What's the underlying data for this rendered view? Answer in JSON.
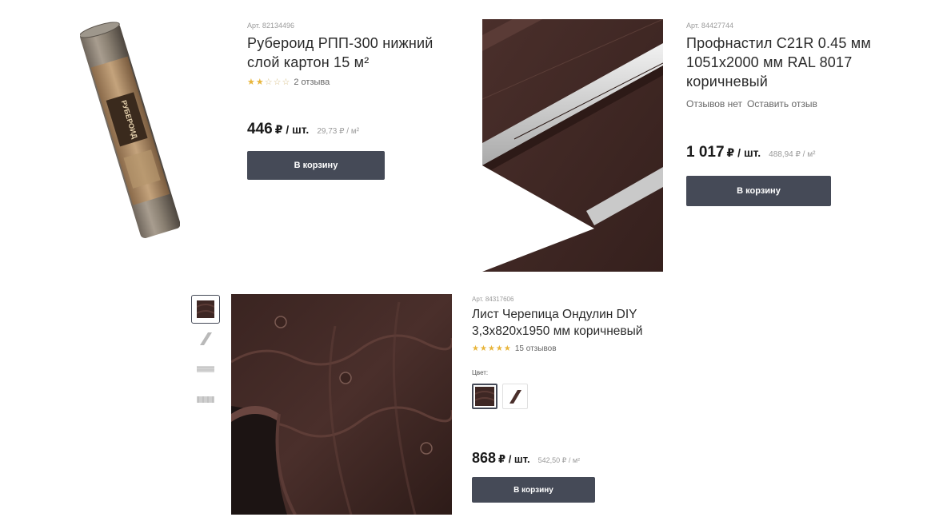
{
  "products": [
    {
      "article": "Арт. 82134496",
      "title_line1": "Рубероид РПП-300 нижний",
      "title_line2": "слой картон 15 м²",
      "rating_stars": 2,
      "reviews": "2 отзыва",
      "price": "446",
      "unit": "₽ / шт.",
      "per_m2": "29,73 ₽ / м²",
      "button": "В корзину",
      "roll_label": "РУБЕРОИД"
    },
    {
      "article": "Арт. 84427744",
      "title_line1": "Профнастил С21R 0.45 мм",
      "title_line2": "1051x2000 мм RAL 8017",
      "title_line3": "коричневый",
      "no_reviews": "Отзывов нет",
      "leave_review": "Оставить отзыв",
      "price": "1 017",
      "unit": "₽ / шт.",
      "per_m2": "488,94 ₽ / м²",
      "button": "В корзину"
    },
    {
      "article": "Арт. 84317606",
      "title_line1": "Лист Черепица Ондулин DIY",
      "title_line2": "3,3x820x1950 мм коричневый",
      "rating_stars": 5,
      "reviews": "15 отзывов",
      "color_label": "Цвет:",
      "price": "868",
      "unit": "₽ / шт.",
      "per_m2": "542,50 ₽ / м²",
      "button": "В корзину"
    }
  ],
  "colors": {
    "button_bg": "#454a57",
    "star": "#e8b53b",
    "sheet_brown": "#3e2724"
  },
  "icons": [
    "star-icon",
    "thumbnail-image"
  ]
}
